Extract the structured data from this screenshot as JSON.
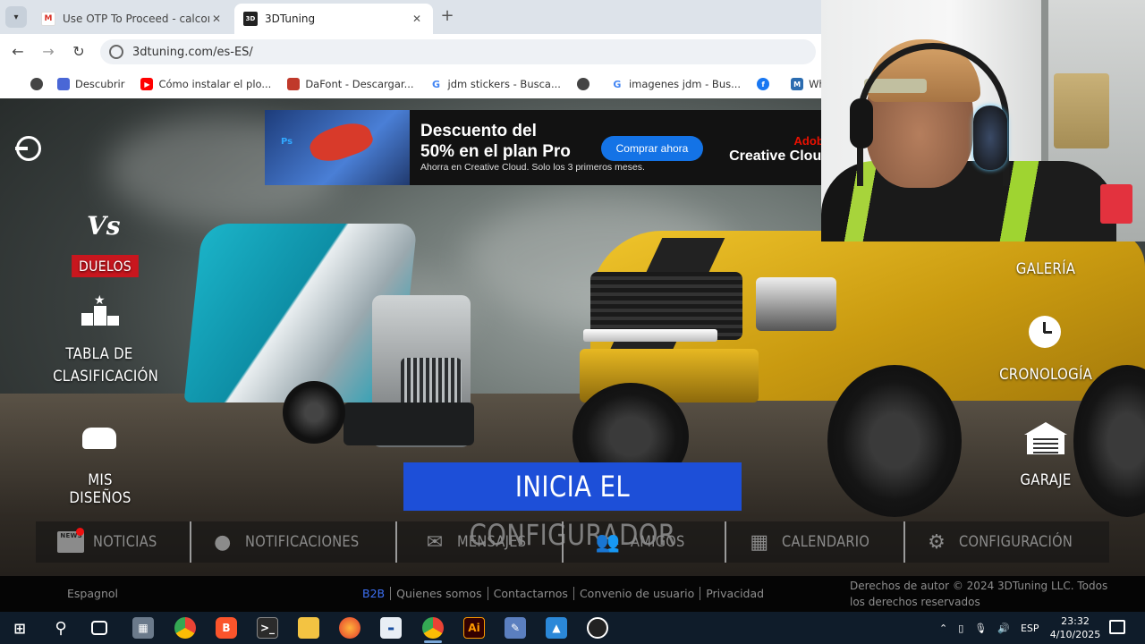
{
  "browser": {
    "tabs": [
      {
        "title": "Use OTP To Proceed - calcomar",
        "favicon": "gmail-icon"
      },
      {
        "title": "3DTuning",
        "favicon": "3dtuning-icon",
        "active": true
      }
    ],
    "url": "3dtuning.com/es-ES/",
    "bookmarks": [
      {
        "label": "Descubrir",
        "icon": "discover-icon",
        "color": "#4a67d6"
      },
      {
        "label": "Cómo instalar el plo...",
        "icon": "youtube-icon",
        "color": "#ff0000"
      },
      {
        "label": "DaFont - Descargar...",
        "icon": "dafont-icon",
        "color": "#c0392b"
      },
      {
        "label": "jdm stickers - Busca...",
        "icon": "google-icon",
        "color": "#4285f4"
      },
      {
        "label": "",
        "icon": "globe-icon",
        "color": "#444444"
      },
      {
        "label": "imagenes jdm - Bus...",
        "icon": "google-icon",
        "color": "#4285f4"
      },
      {
        "label": "",
        "icon": "facebook-icon",
        "color": "#1877f2"
      },
      {
        "label": "WhatTheFont! « M",
        "icon": "myfonts-icon",
        "color": "#2b6cb0"
      }
    ]
  },
  "ad": {
    "headline_1": "Descuento del",
    "headline_2": "50% en el plan Pro",
    "subtitle": "Ahorra en Creative Cloud. Solo los 3 primeros meses.",
    "button": "Comprar ahora",
    "brand_top": "Adobe",
    "brand_bottom": "Creative Cloud",
    "thumb_badge": "Ps"
  },
  "left_menu": {
    "duels_icon_text": "Vs",
    "duels": "DUELOS",
    "leaderboard": [
      "TABLA DE",
      "CLASIFICACIÓN"
    ],
    "my_designs": "MIS DISEÑOS"
  },
  "right_menu": {
    "gallery": "GALERÍA",
    "timeline": "CRONOLOGÍA",
    "garage": "GARAJE"
  },
  "cta": "INICIA EL CONFIGURADOR",
  "bottom_nav": [
    {
      "label": "NOTICIAS",
      "icon": "news-icon",
      "has_dot": true
    },
    {
      "label": "NOTIFICACIONES",
      "icon": "globe-icon"
    },
    {
      "label": "MENSAJES",
      "icon": "envelope-icon"
    },
    {
      "label": "AMIGOS",
      "icon": "friends-icon"
    },
    {
      "label": "CALENDARIO",
      "icon": "calendar-icon"
    },
    {
      "label": "CONFIGURACIÓN",
      "icon": "gear-icon"
    }
  ],
  "news_icon_text": "NEWS",
  "footer": {
    "language": "Espagnol",
    "links": [
      "B2B",
      "Quienes somos",
      "Contactarnos",
      "Convenio de usuario",
      "Privacidad"
    ],
    "copyright": "Derechos de autor © 2024 3DTuning LLC. Todos los derechos reservados"
  },
  "taskbar": {
    "apps": [
      "start",
      "search",
      "task-view",
      "calculator",
      "chrome",
      "brave",
      "terminal",
      "file-explorer",
      "firefox",
      "app-blue",
      "chrome-profile",
      "illustrator",
      "app-editor",
      "photos",
      "obs"
    ],
    "language": "ESP",
    "time": "23:32",
    "date": "4/10/2025"
  },
  "colors": {
    "duels_red": "#c8161e",
    "cta_blue": "#1d4fd8",
    "adobe_red": "#eb1000",
    "ad_button": "#1473e6"
  }
}
